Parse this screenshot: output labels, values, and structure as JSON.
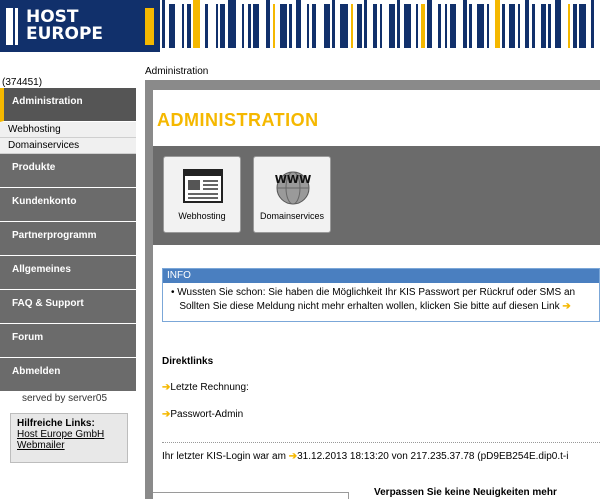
{
  "header": {
    "logo_line1": "HOST",
    "logo_line2": "EUROPE"
  },
  "user_id": "(374451)",
  "breadcrumb": "Administration",
  "sidebar": {
    "items": [
      {
        "label": "Administration",
        "active": true
      },
      {
        "label": "Webhosting",
        "sub": true
      },
      {
        "label": "Domainservices",
        "sub": true
      },
      {
        "label": "Produkte"
      },
      {
        "label": "Kundenkonto"
      },
      {
        "label": "Partnerprogramm"
      },
      {
        "label": "Allgemeines"
      },
      {
        "label": "FAQ & Support"
      },
      {
        "label": "Forum"
      },
      {
        "label": "Abmelden"
      }
    ],
    "served_by": "served by server05",
    "help": {
      "title": "Hilfreiche Links:",
      "links": [
        "Host Europe GmbH",
        "Webmailer"
      ]
    }
  },
  "main": {
    "title": "ADMINISTRATION",
    "tiles": [
      {
        "label": "Webhosting",
        "icon": "webhosting-icon"
      },
      {
        "label": "Domainservices",
        "icon": "www-globe-icon"
      }
    ],
    "info": {
      "heading": "INFO",
      "line1": "Wussten Sie schon: Sie haben die Möglichkeit Ihr KIS Passwort per Rückruf oder SMS an",
      "line2": "Sollten Sie diese Meldung nicht mehr erhalten wollen, klicken Sie bitte auf diesen Link"
    },
    "direktlinks": {
      "title": "Direktlinks",
      "links": [
        "Letzte Rechnung:",
        "Passwort-Admin"
      ]
    },
    "last_login_prefix": "Ihr letzter KIS-Login war am",
    "last_login_value": "31.12.2013 18:13:20 von 217.235.37.78 (pD9EB254E.dip0.t-i",
    "news_title": "Verpassen Sie keine Neuigkeiten mehr"
  },
  "colors": {
    "brand_blue": "#11306b",
    "accent_yellow": "#f5b800",
    "nav_gray": "#6b6b6b",
    "info_blue": "#4a7fc0"
  }
}
